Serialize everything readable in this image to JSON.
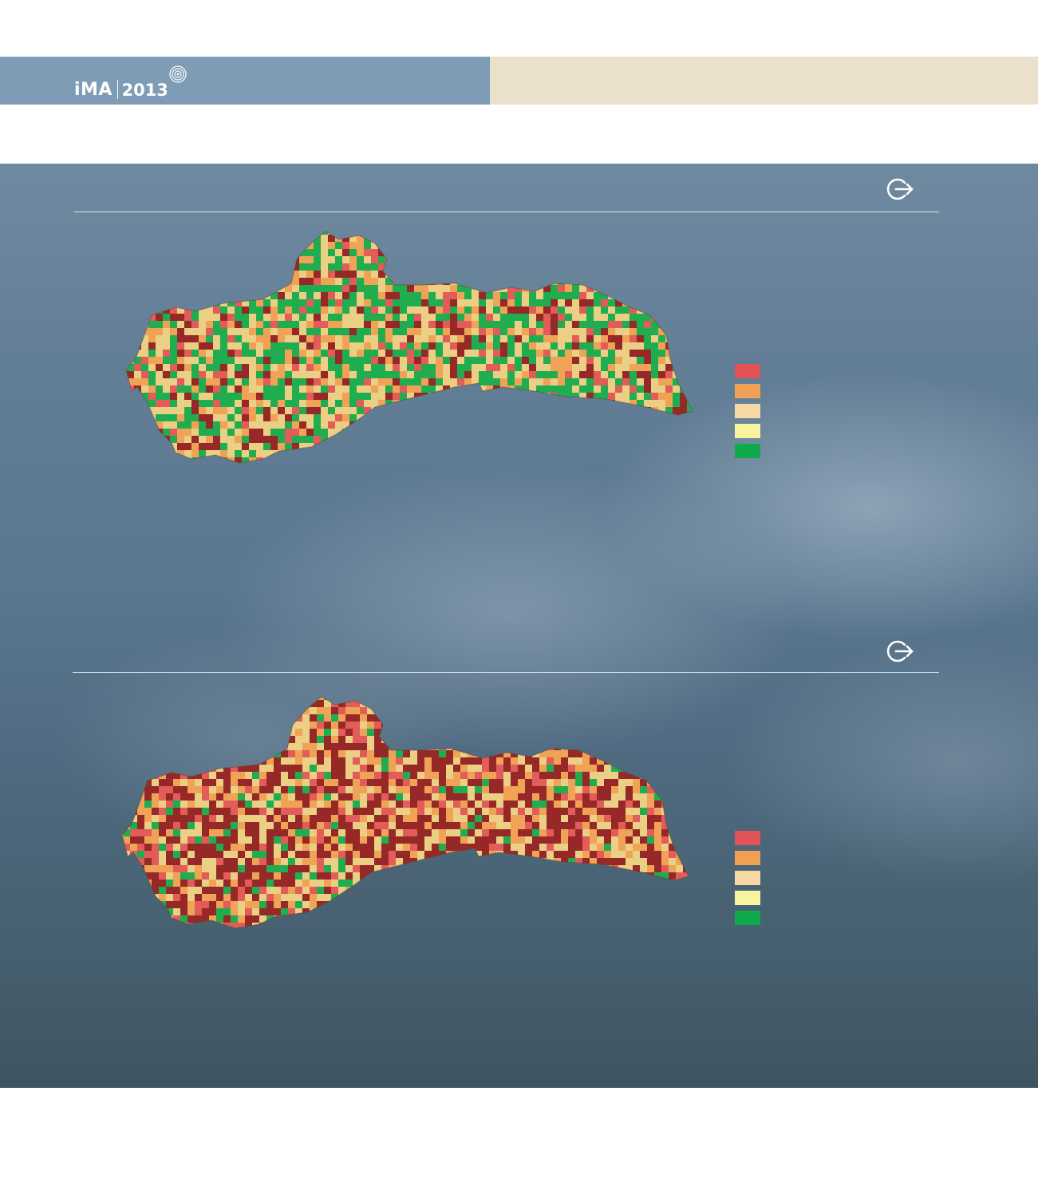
{
  "header": {
    "logo_brand": "iMA",
    "logo_year": "2013",
    "colors": {
      "left_band": "#7e9cb5",
      "right_band": "#ebe0cc"
    }
  },
  "panels": [
    {
      "exit_icon": "exit-arrow-icon",
      "legend": {
        "swatches": [
          {
            "color": "#e15356"
          },
          {
            "color": "#f0a054"
          },
          {
            "color": "#f7d8a4"
          },
          {
            "color": "#f8f39e"
          },
          {
            "color": "#0eaa4c"
          }
        ]
      }
    },
    {
      "exit_icon": "exit-arrow-icon",
      "legend": {
        "swatches": [
          {
            "color": "#e15356"
          },
          {
            "color": "#f0a054"
          },
          {
            "color": "#f7d8a4"
          },
          {
            "color": "#f8f39e"
          },
          {
            "color": "#0eaa4c"
          }
        ]
      }
    }
  ],
  "map_palette": {
    "very_high": "#8e1a1f",
    "high": "#e15356",
    "medium": "#f0a054",
    "low": "#e9cf86",
    "very_low": "#0eaa4c"
  }
}
